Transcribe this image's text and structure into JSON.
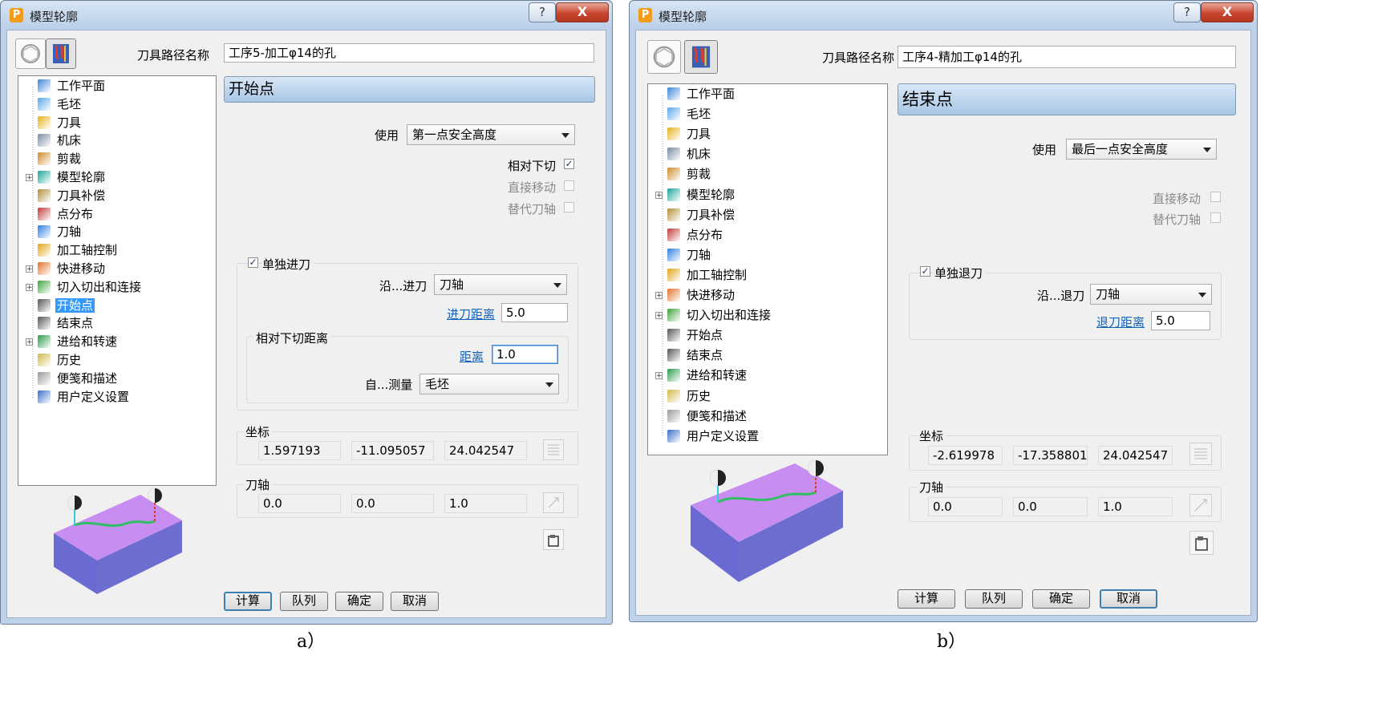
{
  "left": {
    "title": "模型轮廓",
    "help": "?",
    "close": "X",
    "app_letter": "P",
    "path_label": "刀具路径名称",
    "path_value": "工序5-加工φ14的孔",
    "section_title": "开始点",
    "use_label": "使用",
    "use_value": "第一点安全高度",
    "relative_plunge": "相对下切",
    "direct_move": "直接移动",
    "alt_axis": "替代刀轴",
    "separate_approach": "单独进刀",
    "along_label": "沿...进刀",
    "along_value": "刀轴",
    "dist_label": "进刀距离",
    "dist_value": "5.0",
    "rel_plunge_dist": "相对下切距离",
    "distance_label": "距离",
    "distance_value": "1.0",
    "measure_label": "自...测量",
    "measure_value": "毛坯",
    "coord_label": "坐标",
    "coords": [
      "1.597193",
      "-11.095057",
      "24.042547"
    ],
    "axis_label": "刀轴",
    "axis": [
      "0.0",
      "0.0",
      "1.0"
    ],
    "buttons": [
      "计算",
      "队列",
      "确定",
      "取消"
    ]
  },
  "right": {
    "title": "模型轮廓",
    "help": "?",
    "close": "X",
    "app_letter": "P",
    "path_label": "刀具路径名称",
    "path_value": "工序4-精加工φ14的孔",
    "section_title": "结束点",
    "use_label": "使用",
    "use_value": "最后一点安全高度",
    "direct_move": "直接移动",
    "alt_axis": "替代刀轴",
    "separate_retract": "单独退刀",
    "along_label": "沿...退刀",
    "along_value": "刀轴",
    "dist_label": "退刀距离",
    "dist_value": "5.0",
    "coord_label": "坐标",
    "coords": [
      "-2.619978",
      "-17.358801",
      "24.042547"
    ],
    "axis_label": "刀轴",
    "axis": [
      "0.0",
      "0.0",
      "1.0"
    ],
    "buttons": [
      "计算",
      "队列",
      "确定",
      "取消"
    ]
  },
  "tree_items": [
    "工作平面",
    "毛坯",
    "刀具",
    "机床",
    "剪裁",
    "模型轮廓",
    "刀具补偿",
    "点分布",
    "刀轴",
    "加工轴控制",
    "快进移动",
    "切入切出和连接",
    "开始点",
    "结束点",
    "进给和转速",
    "历史",
    "便笺和描述",
    "用户定义设置"
  ],
  "captions": {
    "a": "a）",
    "b": "b）"
  }
}
